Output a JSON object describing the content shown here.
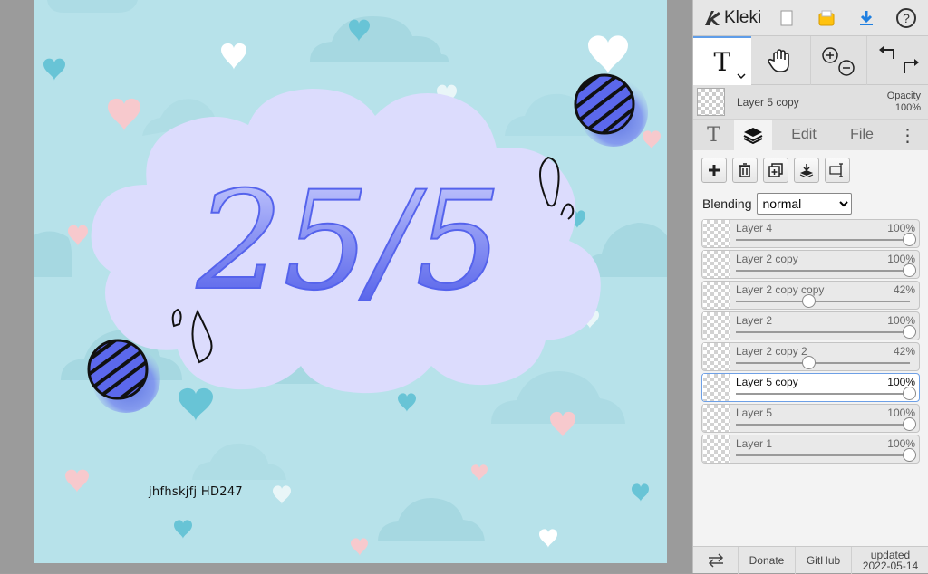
{
  "app": {
    "name": "Kleki",
    "accent": "#1f7fe0"
  },
  "canvas": {
    "title_text": "25/5",
    "signature": "jhfhskjfj HD247",
    "background": "#b7e2ea"
  },
  "toolbar": {
    "icons": [
      "new-image-icon",
      "save-icon",
      "download-icon",
      "help-icon"
    ],
    "help_label": "?"
  },
  "tools": {
    "text_label": "T",
    "hand_icon": "hand-icon",
    "zoom_icons": [
      "zoom-in-icon",
      "zoom-out-icon"
    ],
    "undo_icons": [
      "undo-icon",
      "redo-icon"
    ]
  },
  "current_layer": {
    "name": "Layer 5 copy",
    "opacity_label": "Opacity",
    "opacity_value": "100%"
  },
  "tabs": {
    "text": "T",
    "edit": "Edit",
    "file": "File",
    "more": "⋮"
  },
  "layer_actions": [
    "add-layer-icon",
    "delete-layer-icon",
    "duplicate-layer-icon",
    "merge-down-icon",
    "rename-layer-icon"
  ],
  "blending": {
    "label": "Blending",
    "value": "normal"
  },
  "layers": [
    {
      "name": "Layer 4",
      "opacity": "100%",
      "value": 1.0,
      "active": false
    },
    {
      "name": "Layer 2 copy",
      "opacity": "100%",
      "value": 1.0,
      "active": false
    },
    {
      "name": "Layer 2 copy copy",
      "opacity": "42%",
      "value": 0.42,
      "active": false
    },
    {
      "name": "Layer 2",
      "opacity": "100%",
      "value": 1.0,
      "active": false
    },
    {
      "name": "Layer 2 copy 2",
      "opacity": "42%",
      "value": 0.42,
      "active": false
    },
    {
      "name": "Layer 5 copy",
      "opacity": "100%",
      "value": 1.0,
      "active": true
    },
    {
      "name": "Layer 5",
      "opacity": "100%",
      "value": 1.0,
      "active": false
    },
    {
      "name": "Layer 1",
      "opacity": "100%",
      "value": 1.0,
      "active": false
    }
  ],
  "footer": {
    "swap_icon": "swap-icon",
    "donate": "Donate",
    "github": "GitHub",
    "updated_label": "updated",
    "updated_date": "2022-05-14"
  }
}
